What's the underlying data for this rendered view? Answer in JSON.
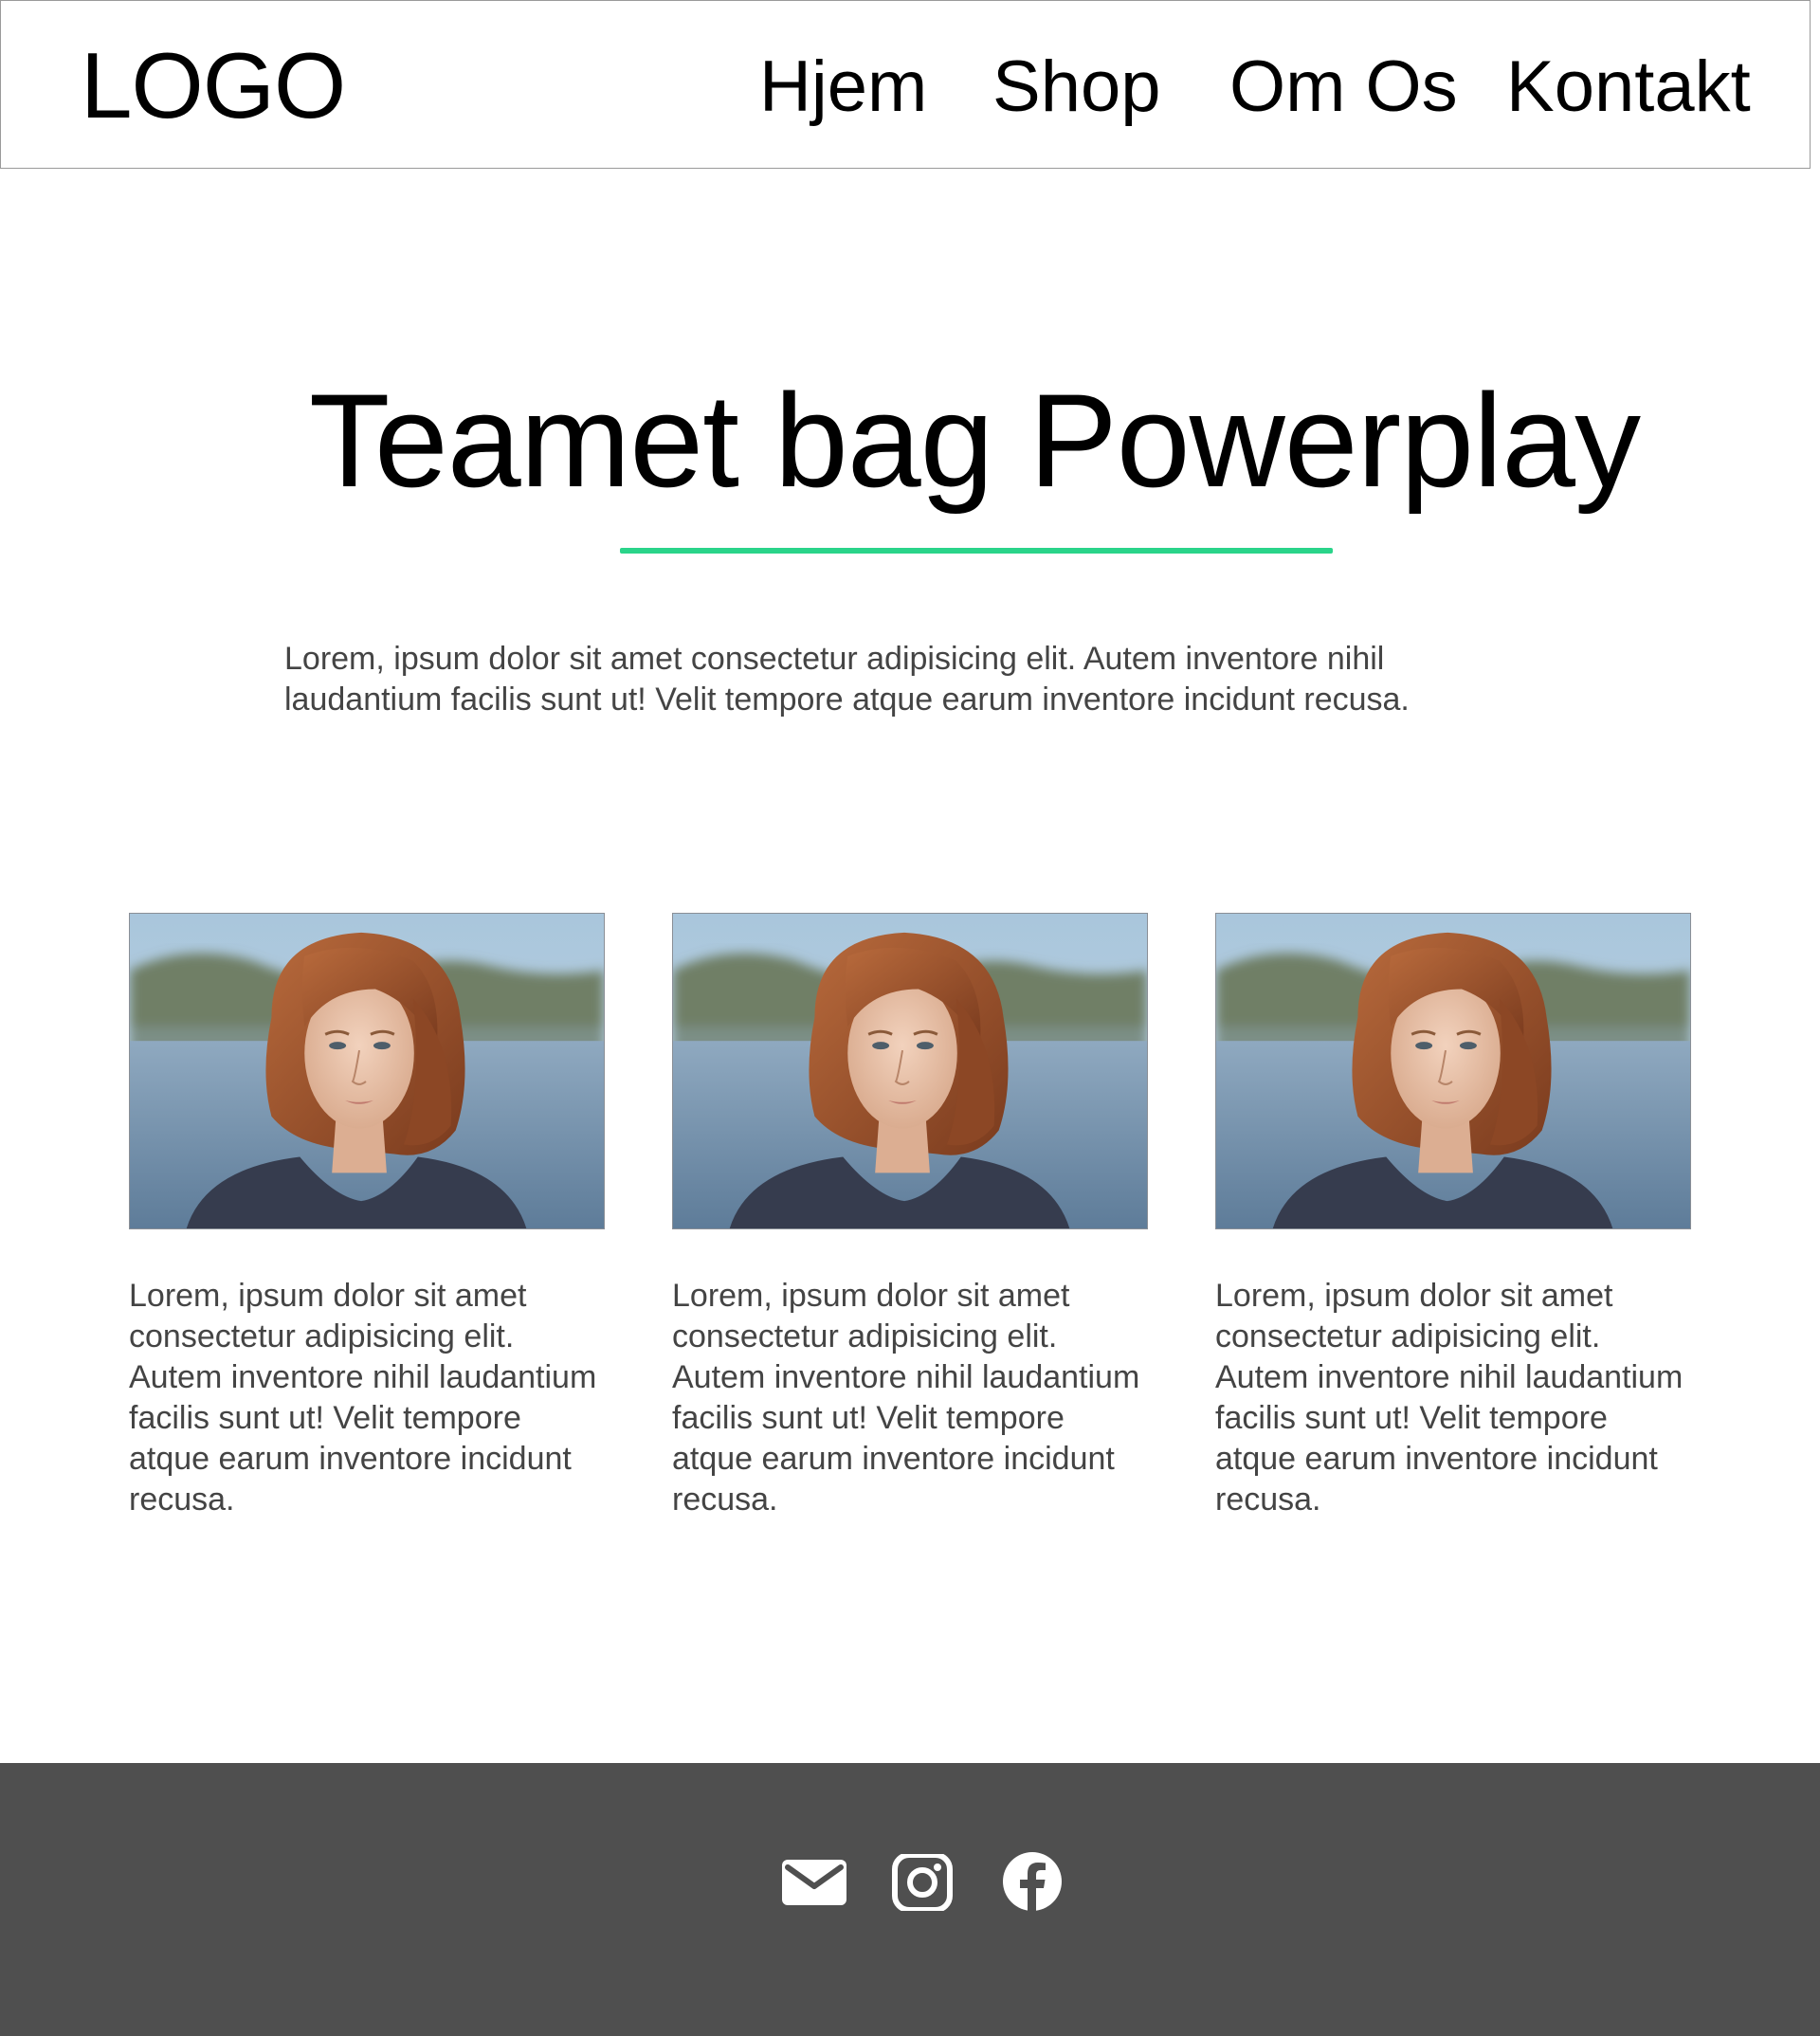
{
  "header": {
    "logo": "LOGO",
    "nav": [
      {
        "label": "Hjem"
      },
      {
        "label": "Shop"
      },
      {
        "label": "Om Os"
      },
      {
        "label": "Kontakt"
      }
    ]
  },
  "hero": {
    "title": "Teamet bag Powerplay",
    "accent_color": "#2ad48a",
    "intro": "Lorem, ipsum dolor sit amet consectetur adipisicing elit. Autem inventore nihil laudantium facilis sunt ut! Velit tempore atque earum inventore incidunt recusa."
  },
  "team": [
    {
      "photo_icon": "team-member-portrait",
      "text": "Lorem, ipsum dolor sit amet consectetur adipisicing elit. Autem inventore nihil laudantium facilis sunt ut! Velit tempore atque earum inventore incidunt recusa."
    },
    {
      "photo_icon": "team-member-portrait",
      "text": "Lorem, ipsum dolor sit amet consectetur adipisicing elit. Autem inventore nihil laudantium facilis sunt ut! Velit tempore atque earum inventore incidunt recusa."
    },
    {
      "photo_icon": "team-member-portrait",
      "text": "Lorem, ipsum dolor sit amet consectetur adipisicing elit. Autem inventore nihil laudantium facilis sunt ut! Velit tempore atque earum inventore incidunt recusa."
    }
  ],
  "footer": {
    "background_color": "#4f4f4f",
    "icons": [
      "mail-icon",
      "instagram-icon",
      "facebook-icon"
    ]
  }
}
